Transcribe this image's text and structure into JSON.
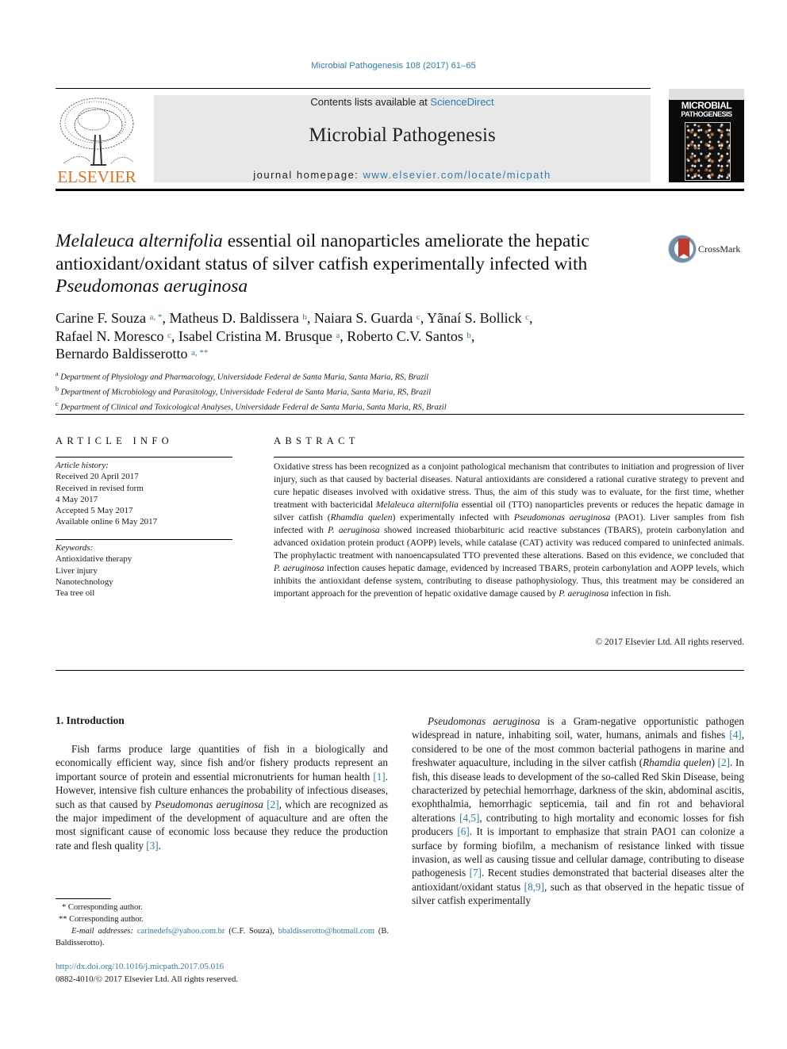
{
  "running_header": "Microbial Pathogenesis 108 (2017) 61–65",
  "publisher_logo_label": "ELSEVIER",
  "banner": {
    "contents_prefix": "Contents lists available at ",
    "contents_link": "ScienceDirect",
    "journal_title": "Microbial Pathogenesis",
    "homepage_prefix": "journal homepage: ",
    "homepage_link": "www.elsevier.com/locate/micpath"
  },
  "cover": {
    "line1": "MICROBIAL",
    "line2": "PATHOGENESIS"
  },
  "crossmark_label": "CrossMark",
  "article": {
    "title_italic": "Melaleuca alternifolia",
    "title_rest1": " essential oil nanoparticles ameliorate the hepatic antioxidant/oxidant status of silver catfish experimentally infected with ",
    "title_italic2": "Pseudomonas aeruginosa",
    "authors": [
      {
        "name": "Carine F. Souza",
        "aff": "a, *"
      },
      {
        "name": "Matheus D. Baldissera",
        "aff": "b"
      },
      {
        "name": "Naiara S. Guarda",
        "aff": "c"
      },
      {
        "name": "Yãnaí S. Bollick",
        "aff": "c"
      },
      {
        "name": "Rafael N. Moresco",
        "aff": "c"
      },
      {
        "name": "Isabel Cristina M. Brusque",
        "aff": "a"
      },
      {
        "name": "Roberto C.V. Santos",
        "aff": "b"
      },
      {
        "name": "Bernardo Baldisserotto",
        "aff": "a, **"
      }
    ],
    "affiliations": [
      {
        "key": "a",
        "text": "Department of Physiology and Pharmacology, Universidade Federal de Santa Maria, Santa Maria, RS, Brazil"
      },
      {
        "key": "b",
        "text": "Department of Microbiology and Parasitology, Universidade Federal de Santa Maria, Santa Maria, RS, Brazil"
      },
      {
        "key": "c",
        "text": "Department of Clinical and Toxicological Analyses, Universidade Federal de Santa Maria, Santa Maria, RS, Brazil"
      }
    ]
  },
  "article_info": {
    "heading": "ARTICLE INFO",
    "history_label": "Article history:",
    "history": [
      "Received 20 April 2017",
      "Received in revised form",
      "4 May 2017",
      "Accepted 5 May 2017",
      "Available online 6 May 2017"
    ],
    "keywords_label": "Keywords:",
    "keywords": [
      "Antioxidative therapy",
      "Liver injury",
      "Nanotechnology",
      "Tea tree oil"
    ]
  },
  "abstract": {
    "heading": "ABSTRACT",
    "s1": "Oxidative stress has been recognized as a conjoint pathological mechanism that contributes to initiation and progression of liver injury, such as that caused by bacterial diseases. Natural antioxidants are considered a rational curative strategy to prevent and cure hepatic diseases involved with oxidative stress. Thus, the aim of this study was to evaluate, for the first time, whether treatment with bactericidal ",
    "i1": "Melaleuca alternifolia",
    "s2": " essential oil (TTO) nanoparticles prevents or reduces the hepatic damage in silver catfish (",
    "i2": "Rhamdia quelen",
    "s3": ") experimentally infected with ",
    "i3": "Pseudomonas aeruginosa",
    "s4": " (PAO1). Liver samples from fish infected with ",
    "i4": "P. aeruginosa",
    "s5": " showed increased thiobarbituric acid reactive substances (TBARS), protein carbonylation and advanced oxidation protein product (AOPP) levels, while catalase (CAT) activity was reduced compared to uninfected animals. The prophylactic treatment with nanoencapsulated TTO prevented these alterations. Based on this evidence, we concluded that ",
    "i5": "P. aeruginosa",
    "s6": " infection causes hepatic damage, evidenced by increased TBARS, protein carbonylation and AOPP levels, which inhibits the antioxidant defense system, contributing to disease pathophysiology. Thus, this treatment may be considered an important approach for the prevention of hepatic oxidative damage caused by ",
    "i6": "P. aeruginosa",
    "s7": " infection in fish.",
    "copyright": "© 2017 Elsevier Ltd. All rights reserved."
  },
  "intro": {
    "heading": "1.  Introduction",
    "p1": {
      "a": "Fish farms produce large quantities of fish in a biologically and economically efficient way, since fish and/or fishery products represent an important source of protein and essential micronutrients for human health ",
      "r1": "[1]",
      "b": ". However, intensive fish culture enhances the probability of infectious diseases, such as that caused by ",
      "i1": "Pseudomonas aeruginosa",
      "c": " ",
      "r2": "[2]",
      "d": ", which are recognized as the major impediment of the development of aquaculture and are often the most significant cause of economic loss because they reduce the production rate and flesh quality ",
      "r3": "[3]",
      "e": "."
    },
    "p2": {
      "i1": "Pseudomonas aeruginosa",
      "a": " is a Gram-negative opportunistic pathogen widespread in nature, inhabiting soil, water, humans, animals and fishes ",
      "r4": "[4]",
      "b": ", considered to be one of the most common bacterial pathogens in marine and freshwater aquaculture, including in the silver catfish (",
      "i2": "Rhamdia quelen",
      "c": ") ",
      "r2": "[2]",
      "d": ". In fish, this disease leads to development of the so-called Red Skin Disease, being characterized by petechial hemorrhage, darkness of the skin, abdominal ascitis, exophthalmia, hemorrhagic septicemia, tail and fin rot and behavioral alterations ",
      "r45": "[4,5]",
      "e": ", contributing to high mortality and economic losses for fish producers ",
      "r6": "[6]",
      "f": ". It is important to emphasize that strain PAO1 can colonize a surface by forming biofilm, a mechanism of resistance linked with tissue invasion, as well as causing tissue and cellular damage, contributing to disease pathogenesis ",
      "r7": "[7]",
      "g": ". Recent studies demonstrated that bacterial diseases alter the antioxidant/oxidant status ",
      "r89": "[8,9]",
      "h": ", such as that observed in the hepatic tissue of silver catfish experimentally"
    }
  },
  "footnotes": {
    "star1": "* Corresponding author.",
    "star2": "** Corresponding author.",
    "email_label": "E-mail addresses:",
    "email1": "carinedefs@yahoo.com.br",
    "email1_owner": " (C.F. Souza), ",
    "email2": "bbaldisserotto@hotmail.com",
    "email2_owner": " (B. Baldisserotto).",
    "doi": "http://dx.doi.org/10.1016/j.micpath.2017.05.016",
    "issn": "0882-4010/© 2017 Elsevier Ltd. All rights reserved."
  }
}
